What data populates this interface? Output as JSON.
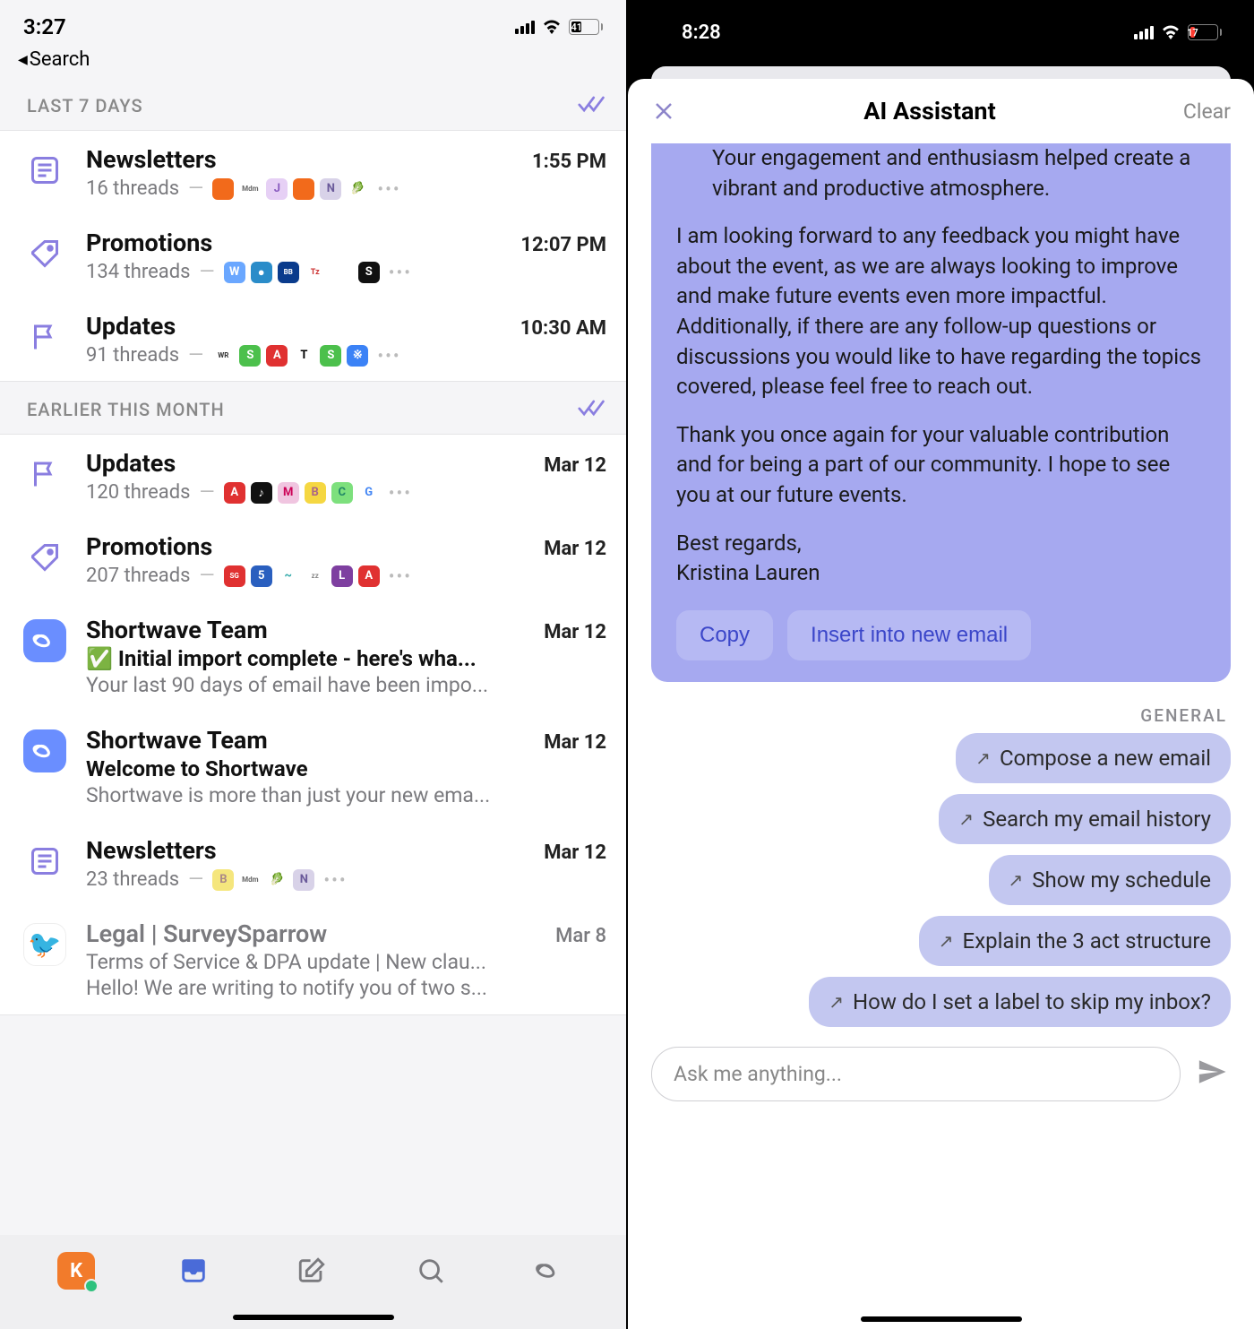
{
  "left": {
    "status": {
      "time": "3:27",
      "battery": "41"
    },
    "back": "Search",
    "sections": [
      {
        "label": "LAST 7 DAYS",
        "rows": [
          {
            "icon": "newsletter",
            "title": "Newsletters",
            "time": "1:55 PM",
            "sub": "16 threads",
            "chips": [
              {
                "bg": "#f26a1b",
                "txt": ""
              },
              {
                "bg": "#fff",
                "txt": "Mdm",
                "fg": "#666",
                "sz": "8px"
              },
              {
                "bg": "#e6d0f5",
                "txt": "J",
                "fg": "#8a5cc0"
              },
              {
                "bg": "#f26a1b",
                "txt": ""
              },
              {
                "bg": "#d8d2e8",
                "txt": "N",
                "fg": "#6a5a9a"
              },
              {
                "bg": "#fff",
                "txt": "🥬"
              }
            ]
          },
          {
            "icon": "tag",
            "title": "Promotions",
            "time": "12:07 PM",
            "sub": "134 threads",
            "chips": [
              {
                "bg": "#6aa7ff",
                "txt": "W"
              },
              {
                "bg": "#2a8cc9",
                "txt": "●"
              },
              {
                "bg": "#0a3b8c",
                "txt": "BB",
                "sz": "8px"
              },
              {
                "bg": "#fff",
                "txt": "Tz",
                "fg": "#c33",
                "sz": "9px"
              },
              {
                "bg": "#fff",
                "txt": ""
              },
              {
                "bg": "#111",
                "txt": "S"
              }
            ]
          },
          {
            "icon": "flag",
            "title": "Updates",
            "time": "10:30 AM",
            "sub": "91 threads",
            "chips": [
              {
                "bg": "#fff",
                "txt": "WR",
                "fg": "#333",
                "sz": "8px"
              },
              {
                "bg": "#4cc04c",
                "txt": "S"
              },
              {
                "bg": "#e03131",
                "txt": "A"
              },
              {
                "bg": "#fff",
                "txt": "T",
                "fg": "#000"
              },
              {
                "bg": "#4cc04c",
                "txt": "S"
              },
              {
                "bg": "#3b82f6",
                "txt": "※"
              }
            ]
          }
        ]
      },
      {
        "label": "EARLIER THIS MONTH",
        "rows": [
          {
            "icon": "flag",
            "title": "Updates",
            "time": "Mar 12",
            "sub": "120 threads",
            "chips": [
              {
                "bg": "#e03131",
                "txt": "A"
              },
              {
                "bg": "#111",
                "txt": "♪"
              },
              {
                "bg": "#f0c5e0",
                "txt": "M",
                "fg": "#c05"
              },
              {
                "bg": "#f5d742",
                "txt": "B",
                "fg": "#a68"
              },
              {
                "bg": "#7de07d",
                "txt": "C",
                "fg": "#286"
              },
              {
                "bg": "#fff",
                "txt": "G",
                "fg": "#4285f4"
              }
            ]
          },
          {
            "icon": "tag",
            "title": "Promotions",
            "time": "Mar 12",
            "sub": "207 threads",
            "chips": [
              {
                "bg": "#e03131",
                "txt": "SG",
                "sz": "8px"
              },
              {
                "bg": "#2a5fbf",
                "txt": "5"
              },
              {
                "bg": "#fff",
                "txt": "~",
                "fg": "#3aa"
              },
              {
                "bg": "#fff",
                "txt": "zz",
                "fg": "#888",
                "sz": "8px"
              },
              {
                "bg": "#7e3fa0",
                "txt": "L"
              },
              {
                "bg": "#e03131",
                "txt": "A"
              }
            ]
          },
          {
            "icon": "app",
            "title": "Shortwave Team",
            "time": "Mar 12",
            "subject": "✅ Initial import complete - here's wha...",
            "preview": "Your last 90 days of email have been impo..."
          },
          {
            "icon": "app",
            "title": "Shortwave Team",
            "time": "Mar 12",
            "subject": "Welcome to Shortwave",
            "preview": "Shortwave is more than just your new ema..."
          },
          {
            "icon": "newsletter",
            "title": "Newsletters",
            "time": "Mar 12",
            "sub": "23 threads",
            "chips": [
              {
                "bg": "#f5e67d",
                "txt": "B",
                "fg": "#a88"
              },
              {
                "bg": "#fff",
                "txt": "Mdm",
                "fg": "#666",
                "sz": "8px"
              },
              {
                "bg": "#fff",
                "txt": "🥬"
              },
              {
                "bg": "#d8d2e8",
                "txt": "N",
                "fg": "#6a5a9a"
              }
            ]
          },
          {
            "icon": "sparrow",
            "title": "Legal | SurveySparrow",
            "time": "Mar 8",
            "read": true,
            "subject2": "Terms of Service & DPA update | New clau...",
            "preview": "Hello! We are writing to notify you of two s..."
          }
        ]
      }
    ],
    "avatar": "K"
  },
  "right": {
    "status": {
      "time": "8:28",
      "battery": "17"
    },
    "sheet": {
      "title": "AI Assistant",
      "clear": "Clear",
      "bubble": {
        "p0": "Your engagement and enthusiasm helped create a vibrant and productive atmosphere.",
        "p1": "I am looking forward to any feedback you might have about the event, as we are always looking to improve and make future events even more impactful. Additionally, if there are any follow-up questions or discussions you would like to have regarding the topics covered, please feel free to reach out.",
        "p2": "Thank you once again for your valuable contribution and for being a part of our community. I hope to see you at our future events.",
        "sig1": "Best regards,",
        "sig2": "Kristina Lauren",
        "copy": "Copy",
        "insert": "Insert into new email"
      },
      "general": "GENERAL",
      "suggestions": [
        "Compose a new email",
        "Search my email history",
        "Show my schedule",
        "Explain the 3 act structure",
        "How do I set a label to skip my inbox?"
      ],
      "placeholder": "Ask me anything..."
    }
  }
}
